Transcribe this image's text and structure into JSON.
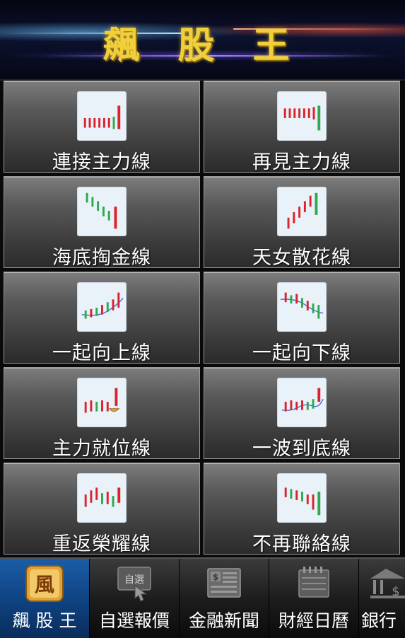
{
  "header": {
    "title": "飆 股 王"
  },
  "grid": {
    "items": [
      {
        "label": "連接主力線",
        "icon": "rising-candles-icon"
      },
      {
        "label": "再見主力線",
        "icon": "falling-candles-icon"
      },
      {
        "label": "海底掏金線",
        "icon": "downtrend-reversal-icon"
      },
      {
        "label": "天女散花線",
        "icon": "uptrend-candles-icon"
      },
      {
        "label": "一起向上線",
        "icon": "moving-average-up-icon"
      },
      {
        "label": "一起向下線",
        "icon": "moving-average-down-icon"
      },
      {
        "label": "主力就位線",
        "icon": "bowl-bottom-icon"
      },
      {
        "label": "一波到底線",
        "icon": "wave-bottom-icon"
      },
      {
        "label": "重返榮耀線",
        "icon": "zigzag-candles-icon"
      },
      {
        "label": "不再聯絡線",
        "icon": "breakdown-candles-icon"
      }
    ]
  },
  "tabbar": {
    "tabs": [
      {
        "label": "飆 股 王",
        "icon": "app-logo-icon",
        "active": true
      },
      {
        "label": "自選報價",
        "icon": "watchlist-icon",
        "active": false
      },
      {
        "label": "金融新聞",
        "icon": "news-icon",
        "active": false
      },
      {
        "label": "財經日曆",
        "icon": "calendar-icon",
        "active": false
      },
      {
        "label": "銀行",
        "icon": "bank-icon",
        "active": false
      }
    ]
  },
  "colors": {
    "title": "#f0cf3a",
    "red": "#d9232d",
    "green": "#2fa84f",
    "active_tab": "#1b5da8"
  }
}
